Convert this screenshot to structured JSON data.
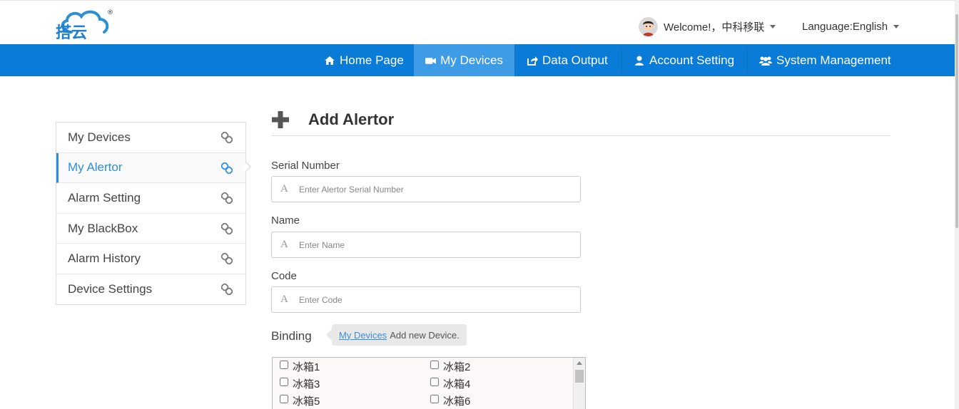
{
  "header": {
    "logo_text": "搭云",
    "registered_mark": "®",
    "welcome": "Welcome!，中科移联",
    "language": "Language:English"
  },
  "nav": {
    "items": [
      {
        "label": "Home Page",
        "icon": "home-icon"
      },
      {
        "label": "My Devices",
        "icon": "video-camera-icon",
        "active": true
      },
      {
        "label": "Data Output",
        "icon": "export-icon"
      },
      {
        "label": "Account Setting",
        "icon": "user-icon"
      },
      {
        "label": "System Management",
        "icon": "users-icon"
      }
    ]
  },
  "sidebar": {
    "items": [
      {
        "label": "My Devices"
      },
      {
        "label": "My Alertor",
        "active": true
      },
      {
        "label": "Alarm Setting"
      },
      {
        "label": "My BlackBox"
      },
      {
        "label": "Alarm History"
      },
      {
        "label": "Device Settings"
      }
    ]
  },
  "form": {
    "title": "Add Alertor",
    "serial": {
      "label": "Serial Number",
      "placeholder": "Enter Alertor Serial Number"
    },
    "name": {
      "label": "Name",
      "placeholder": "Enter Name"
    },
    "code": {
      "label": "Code",
      "placeholder": "Enter Code"
    },
    "binding": {
      "label": "Binding",
      "tooltip_link": "My Devices",
      "tooltip_text": "Add new Device.",
      "devices": [
        "冰箱1",
        "冰箱2",
        "冰箱3",
        "冰箱4",
        "冰箱5",
        "冰箱6"
      ]
    }
  },
  "colors": {
    "nav_bg": "#0a7bd6",
    "nav_active": "#3e9ce6",
    "accent": "#2f8de0"
  }
}
